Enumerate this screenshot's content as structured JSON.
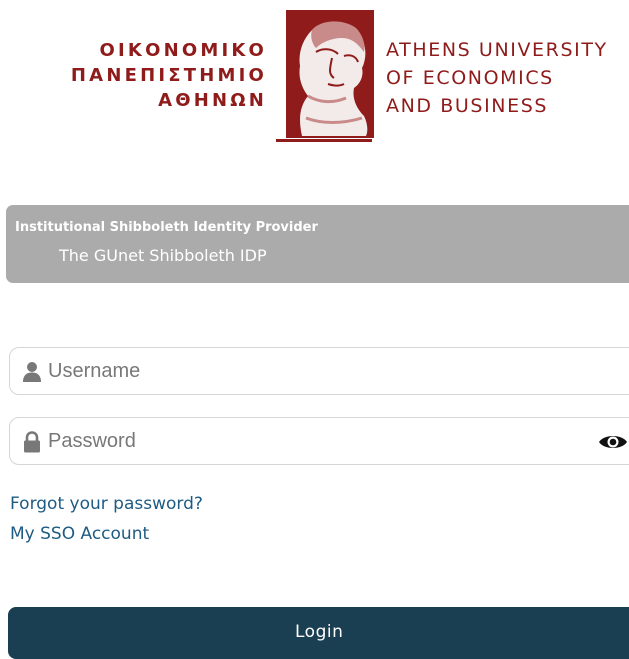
{
  "logo": {
    "greek_lines": [
      "ΟΙΚΟΝΟΜΙΚΟ",
      "ΠΑΝΕΠΙΣΤΗΜΙΟ",
      "ΑΘΗΝΩΝ"
    ],
    "english_lines": [
      "ATHENS UNIVERSITY",
      "OF ECONOMICS",
      "AND BUSINESS"
    ],
    "icon": "hermes-bust-icon",
    "color": "#8f1b1b"
  },
  "idp": {
    "title": "Institutional Shibboleth Identity Provider",
    "subtitle": "The GUnet Shibboleth IDP",
    "background": "#ababab"
  },
  "form": {
    "username": {
      "placeholder": "Username",
      "value": "",
      "icon": "user-icon"
    },
    "password": {
      "placeholder": "Password",
      "value": "",
      "icon": "lock-icon",
      "toggle_icon": "eye-icon"
    },
    "forgot_password": "Forgot your password?",
    "sso_account": "My SSO Account",
    "link_color": "#1e5b82",
    "login_label": "Login",
    "login_color": "#1a3f52"
  }
}
